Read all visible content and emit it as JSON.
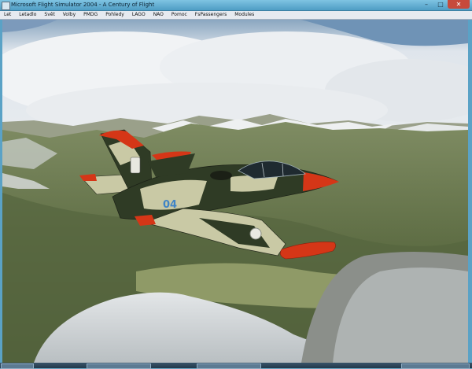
{
  "window": {
    "title": "Microsoft Flight Simulator 2004 - A Century of Flight",
    "minimize_glyph": "–",
    "maximize_glyph": "□",
    "close_glyph": "✕"
  },
  "menu": {
    "items": [
      "Let",
      "Letadlo",
      "Svět",
      "Volby",
      "PMDG",
      "Pohledy",
      "LAGO",
      "NAO",
      "Pomoc",
      "FsPassengers",
      "Modules"
    ]
  },
  "scene": {
    "aircraft_number": "04",
    "colors": {
      "camo_dark": "#2f3b25",
      "camo_light": "#c9c9a5",
      "accent_red": "#d53617",
      "number_blue": "#3f84c6"
    }
  },
  "icons": [
    "app-icon",
    "minimize-icon",
    "maximize-icon",
    "close-icon"
  ]
}
